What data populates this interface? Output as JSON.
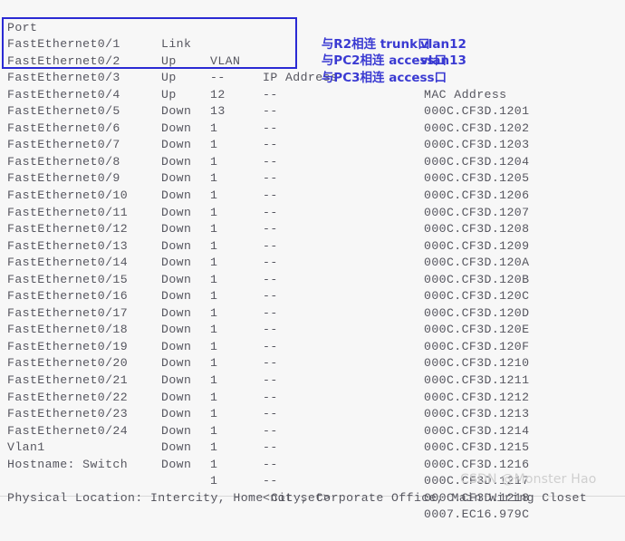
{
  "terminal": {
    "columns": {
      "port": "Port",
      "link": "Link",
      "vlan": "VLAN",
      "ip": "IP Address",
      "mac": "MAC Address"
    },
    "rows": [
      {
        "port": "FastEthernet0/1",
        "link": "Up",
        "vlan": "--",
        "ip": "--",
        "mac": "000C.CF3D.1201"
      },
      {
        "port": "FastEthernet0/2",
        "link": "Up",
        "vlan": "12",
        "ip": "--",
        "mac": "000C.CF3D.1202"
      },
      {
        "port": "FastEthernet0/3",
        "link": "Up",
        "vlan": "13",
        "ip": "--",
        "mac": "000C.CF3D.1203"
      },
      {
        "port": "FastEthernet0/4",
        "link": "Down",
        "vlan": "1",
        "ip": "--",
        "mac": "000C.CF3D.1204"
      },
      {
        "port": "FastEthernet0/5",
        "link": "Down",
        "vlan": "1",
        "ip": "--",
        "mac": "000C.CF3D.1205"
      },
      {
        "port": "FastEthernet0/6",
        "link": "Down",
        "vlan": "1",
        "ip": "--",
        "mac": "000C.CF3D.1206"
      },
      {
        "port": "FastEthernet0/7",
        "link": "Down",
        "vlan": "1",
        "ip": "--",
        "mac": "000C.CF3D.1207"
      },
      {
        "port": "FastEthernet0/8",
        "link": "Down",
        "vlan": "1",
        "ip": "--",
        "mac": "000C.CF3D.1208"
      },
      {
        "port": "FastEthernet0/9",
        "link": "Down",
        "vlan": "1",
        "ip": "--",
        "mac": "000C.CF3D.1209"
      },
      {
        "port": "FastEthernet0/10",
        "link": "Down",
        "vlan": "1",
        "ip": "--",
        "mac": "000C.CF3D.120A"
      },
      {
        "port": "FastEthernet0/11",
        "link": "Down",
        "vlan": "1",
        "ip": "--",
        "mac": "000C.CF3D.120B"
      },
      {
        "port": "FastEthernet0/12",
        "link": "Down",
        "vlan": "1",
        "ip": "--",
        "mac": "000C.CF3D.120C"
      },
      {
        "port": "FastEthernet0/13",
        "link": "Down",
        "vlan": "1",
        "ip": "--",
        "mac": "000C.CF3D.120D"
      },
      {
        "port": "FastEthernet0/14",
        "link": "Down",
        "vlan": "1",
        "ip": "--",
        "mac": "000C.CF3D.120E"
      },
      {
        "port": "FastEthernet0/15",
        "link": "Down",
        "vlan": "1",
        "ip": "--",
        "mac": "000C.CF3D.120F"
      },
      {
        "port": "FastEthernet0/16",
        "link": "Down",
        "vlan": "1",
        "ip": "--",
        "mac": "000C.CF3D.1210"
      },
      {
        "port": "FastEthernet0/17",
        "link": "Down",
        "vlan": "1",
        "ip": "--",
        "mac": "000C.CF3D.1211"
      },
      {
        "port": "FastEthernet0/18",
        "link": "Down",
        "vlan": "1",
        "ip": "--",
        "mac": "000C.CF3D.1212"
      },
      {
        "port": "FastEthernet0/19",
        "link": "Down",
        "vlan": "1",
        "ip": "--",
        "mac": "000C.CF3D.1213"
      },
      {
        "port": "FastEthernet0/20",
        "link": "Down",
        "vlan": "1",
        "ip": "--",
        "mac": "000C.CF3D.1214"
      },
      {
        "port": "FastEthernet0/21",
        "link": "Down",
        "vlan": "1",
        "ip": "--",
        "mac": "000C.CF3D.1215"
      },
      {
        "port": "FastEthernet0/22",
        "link": "Down",
        "vlan": "1",
        "ip": "--",
        "mac": "000C.CF3D.1216"
      },
      {
        "port": "FastEthernet0/23",
        "link": "Down",
        "vlan": "1",
        "ip": "--",
        "mac": "000C.CF3D.1217"
      },
      {
        "port": "FastEthernet0/24",
        "link": "Down",
        "vlan": "1",
        "ip": "--",
        "mac": "000C.CF3D.1218"
      },
      {
        "port": "Vlan1",
        "link": "Down",
        "vlan": "1",
        "ip": "<not set>",
        "mac": "0007.EC16.979C"
      }
    ],
    "hostname_line": "Hostname: Switch",
    "physical_location_line": "Physical Location: Intercity, Home City, Corporate Office, Main Wiring Closet"
  },
  "annotations": {
    "highlight_color": "#2a2ad4",
    "text_color": "#3a3ad2",
    "items": [
      {
        "text": "与R2相连 trunk口",
        "overlay": ""
      },
      {
        "text": "与PC2相连 access口",
        "overlay": "vlan12"
      },
      {
        "text": "与PC3相连 access口",
        "overlay": "vlan13"
      }
    ]
  },
  "watermark": {
    "text": "CSDN @Monster Hao"
  }
}
